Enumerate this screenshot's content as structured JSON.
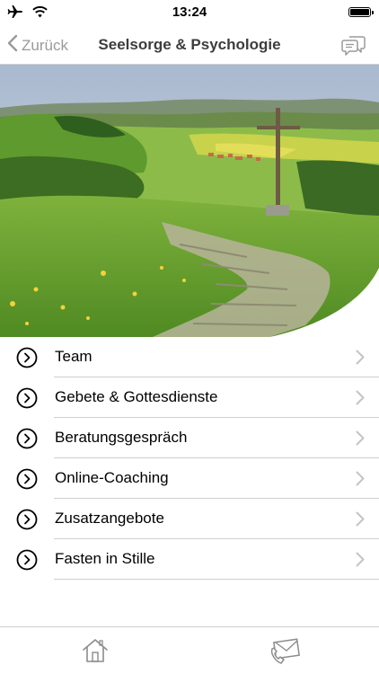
{
  "status_bar": {
    "time": "13:24",
    "icons": [
      "airplane-icon",
      "wifi-icon",
      "battery-icon"
    ]
  },
  "nav": {
    "back_label": "Zurück",
    "title": "Seelsorge & Psychologie",
    "right_icon": "chat-bubbles-icon"
  },
  "hero": {
    "description_icon": "landscape-image"
  },
  "menu": {
    "items": [
      {
        "label": "Team"
      },
      {
        "label": "Gebete & Gottesdienste"
      },
      {
        "label": "Beratungsgespräch"
      },
      {
        "label": "Online-Coaching"
      },
      {
        "label": "Zusatzangebote"
      },
      {
        "label": "Fasten in Stille"
      }
    ]
  },
  "tab_bar": {
    "items": [
      "home-icon",
      "phone-mail-icon"
    ]
  },
  "colors": {
    "accent_gray": "#9a9a9a",
    "title_gray": "#3d3d3d",
    "separator": "#cfcfcf"
  }
}
